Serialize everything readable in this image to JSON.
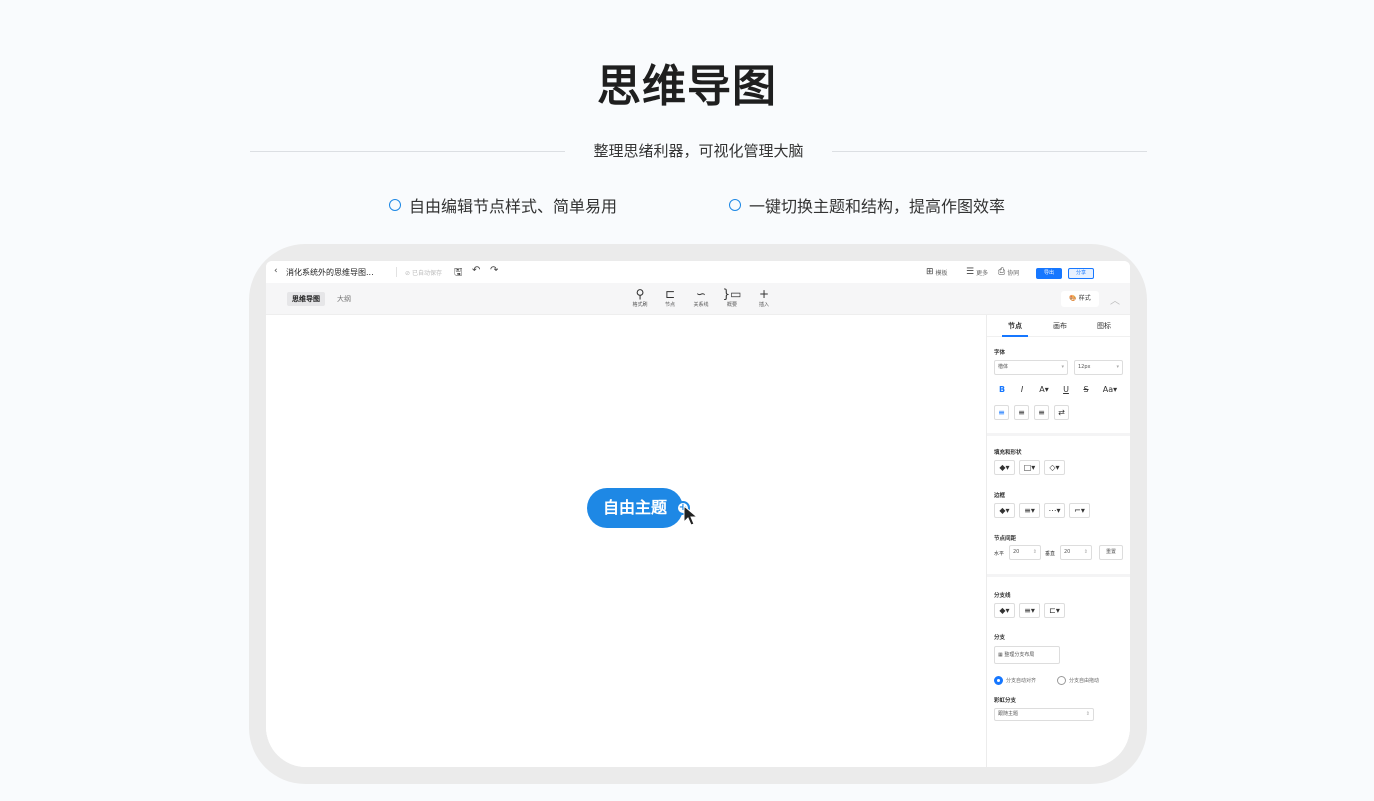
{
  "hero": {
    "title": "思维导图",
    "subtitle": "整理思绪利器，可视化管理大脑",
    "features": [
      "自由编辑节点样式、简单易用",
      "一键切换主题和结构，提高作图效率"
    ]
  },
  "app": {
    "topbar": {
      "back": "‹",
      "doc_title": "消化系统外的思维导图...",
      "autosave": "已自动保存",
      "template": "模板",
      "outline": "更多",
      "print": "协同",
      "export": "导出",
      "share": "分享"
    },
    "toolbar": {
      "tab_mindmap": "思维导图",
      "tab_outline": "大纲",
      "tools": [
        "格式刷",
        "节点",
        "关系线",
        "概要",
        "插入"
      ],
      "style": "样式"
    },
    "canvas": {
      "node_label": "自由主题"
    },
    "panel": {
      "tabs": [
        "节点",
        "画布",
        "图标"
      ],
      "font_section": "字体",
      "font_family": "楷体",
      "font_size": "12px",
      "fill_section": "填充和形状",
      "border_section": "边框",
      "spacing_section": "节点间距",
      "horizontal_label": "水平",
      "horizontal_value": "20",
      "vertical_label": "垂直",
      "vertical_value": "20",
      "reset": "重置",
      "branch_line_section": "分支线",
      "branch_section": "分支",
      "branch_layout_btn": "整理分支布局",
      "radio_auto_align": "分支自动对齐",
      "radio_free_move": "分支自由拖动",
      "rainbow_section": "彩虹分支",
      "rainbow_value": "跟随主题"
    }
  },
  "colors": {
    "accent": "#1e88e5",
    "primary_button": "#1677ff"
  }
}
